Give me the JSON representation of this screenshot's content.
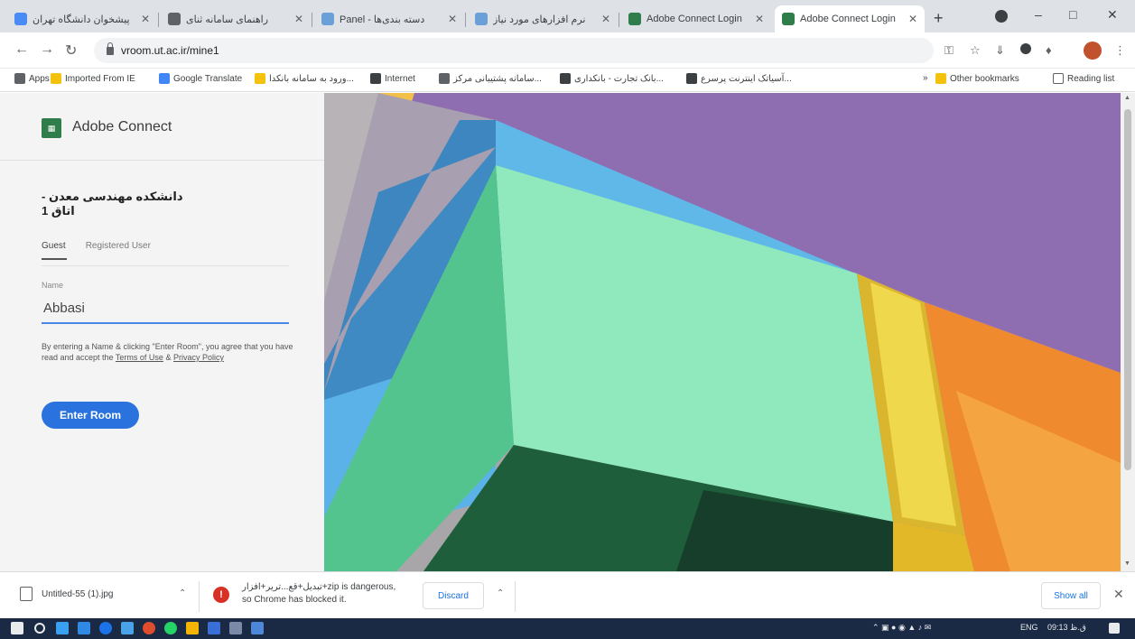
{
  "browser": {
    "tabs": [
      {
        "title": "پیشخوان دانشگاه تهران",
        "active": false,
        "color": "#4b8bf5"
      },
      {
        "title": "راهنمای سامانه ثنای",
        "active": false,
        "color": "#5f6368"
      },
      {
        "title": "Panel - دسته بندی‌ها",
        "active": false,
        "color": "#6a9fd8"
      },
      {
        "title": "نرم افزارهای مورد نیاز",
        "active": false,
        "color": "#6a9fd8"
      },
      {
        "title": "Adobe Connect Login",
        "active": false,
        "color": "#2f7d4a"
      },
      {
        "title": "Adobe Connect Login",
        "active": true,
        "color": "#2f7d4a"
      }
    ],
    "new_tab": "+",
    "url": "vroom.ut.ac.ir/mine1",
    "bookmarks": [
      {
        "label": "Apps",
        "color": "#5f6368"
      },
      {
        "label": "Imported From IE",
        "color": "#f4c20d"
      },
      {
        "label": "Google Translate",
        "color": "#4285f4"
      },
      {
        "label": "ورود به سامانه بانکدا...",
        "color": "#f4c20d"
      },
      {
        "label": "Internet",
        "color": "#3c4043"
      },
      {
        "label": "سامانه پشتیبانی مرکز...",
        "color": "#5f6368"
      },
      {
        "label": "بانک تجارت - بانکداری...",
        "color": "#3c4043"
      },
      {
        "label": "آسیاتک اینترنت پرسرع...",
        "color": "#3c4043"
      }
    ],
    "other_bookmarks": "Other bookmarks",
    "reading_list": "Reading list"
  },
  "panel": {
    "brand": "Adobe Connect",
    "room_title": "دانشکده مهندسی معدن - اتاق 1",
    "tabs": [
      "Guest",
      "Registered User"
    ],
    "name_label": "Name",
    "name_value": "Abbasi",
    "consent_text": "By entering a Name & clicking \"Enter Room\", you agree that you have read and accept the",
    "terms_link": "Terms of Use",
    "consent_and": "&",
    "privacy_link": "Privacy Policy",
    "enter_button": "Enter Room"
  },
  "downloads": {
    "file1": "Untitled-55 (1).jpg",
    "file2_line1": "تبدیل+قع...تریر+افزار+zip is dangerous,",
    "file2_line2": "so Chrome has blocked it.",
    "discard": "Discard",
    "show_all": "Show all"
  },
  "taskbar": {
    "lang": "ENG",
    "time": "09:13 ق.ظ"
  },
  "colors": {
    "accent": "#2a72de",
    "logo": "#2f7d4a",
    "taskbar": "#1b2a44"
  }
}
